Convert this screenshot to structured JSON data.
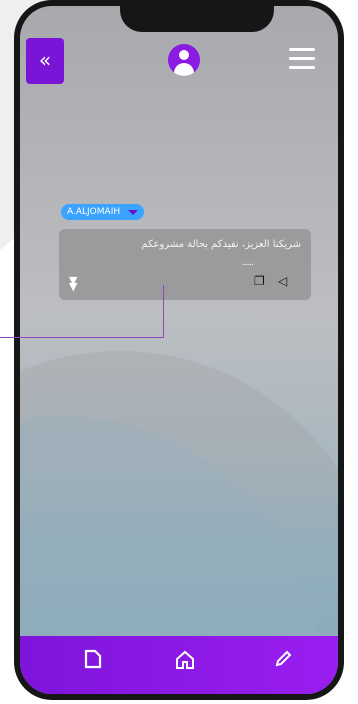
{
  "header": {
    "back_icon": "double-chevron-left-icon",
    "avatar_icon": "user-avatar-icon",
    "menu_icon": "hamburger-menu-icon"
  },
  "message": {
    "sender": "A.ALJOMAIH",
    "text": "شريكنا العزيز، نفيدكم بحالة مشروعكم",
    "ellipsis": "......",
    "actions": [
      "copy-icon",
      "speaker-icon"
    ],
    "expand_icon": "double-chevron-down-icon"
  },
  "bottom_nav": {
    "items": [
      "document-icon",
      "home-icon",
      "edit-icon"
    ]
  },
  "colors": {
    "accent_purple": "#7a14d6",
    "tag_blue": "#3aa3ff",
    "card_gray": "#9b9b9d",
    "phone_frame": "#161616"
  }
}
